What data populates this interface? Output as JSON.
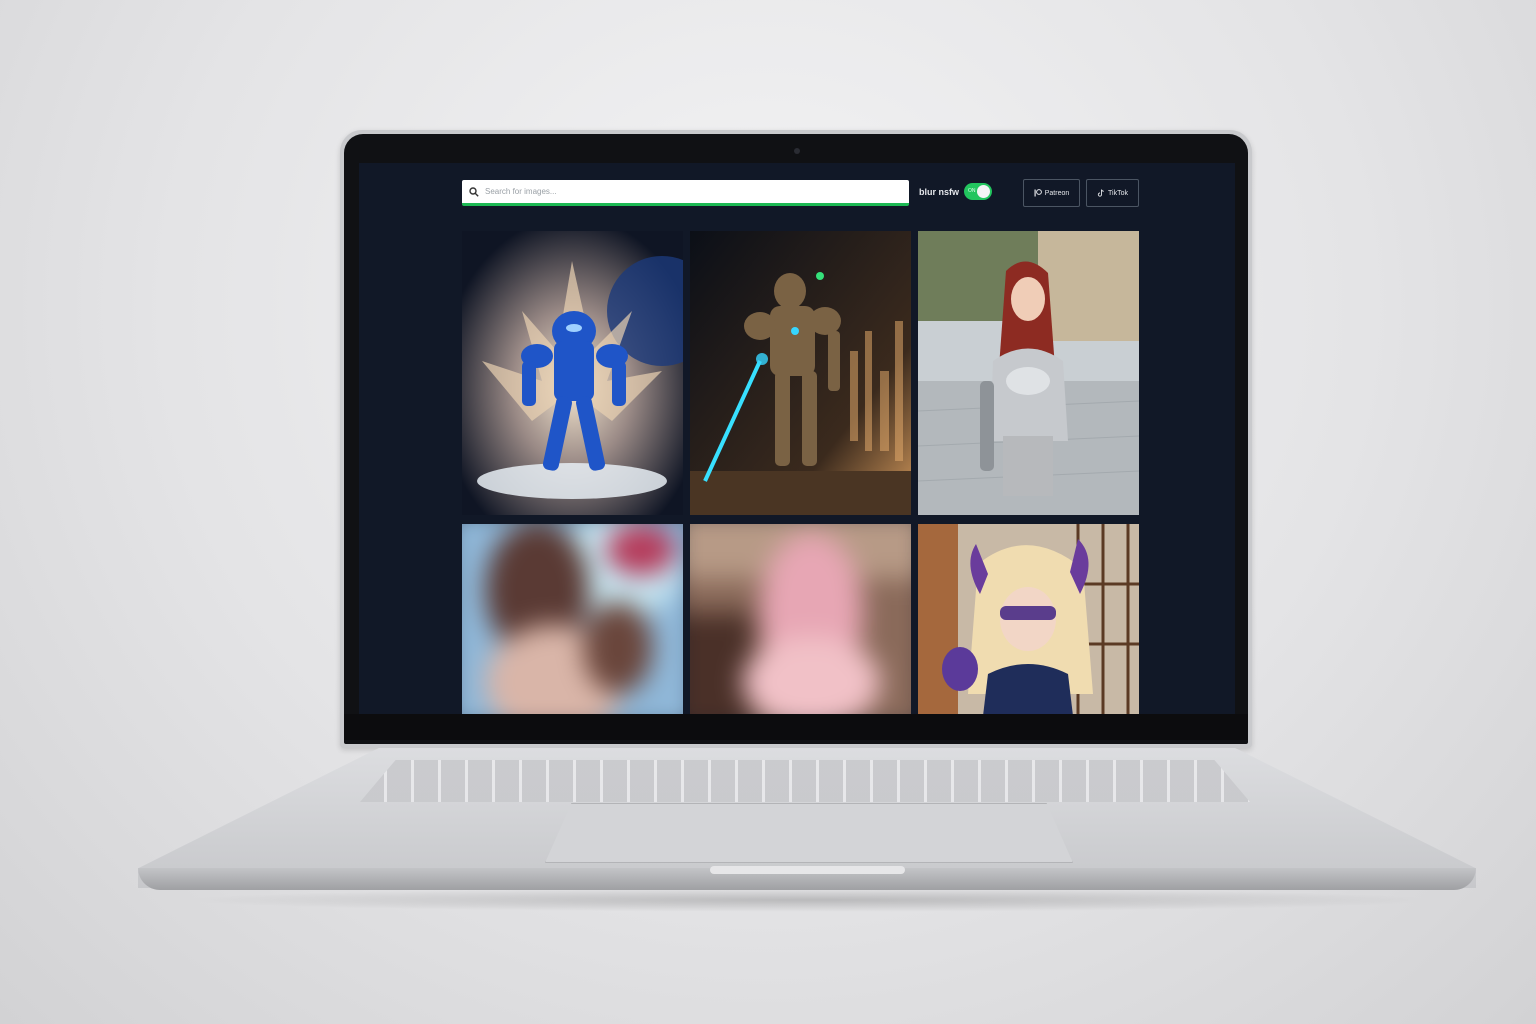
{
  "search": {
    "placeholder": "Search for images..."
  },
  "blur_nsfw": {
    "label": "blur nsfw",
    "state_text": "ON",
    "enabled": true
  },
  "links": {
    "patreon_label": "Patreon",
    "tiktok_label": "TikTok"
  },
  "gallery": {
    "images": [
      {
        "subject": "blue mecha robot",
        "blurred": false
      },
      {
        "subject": "armored warrior with glowing sword",
        "blurred": false
      },
      {
        "subject": "red-haired knight in silver armor",
        "blurred": false
      },
      {
        "subject": "character portrait",
        "blurred": true
      },
      {
        "subject": "pink-haired character",
        "blurred": true
      },
      {
        "subject": "blonde hero with purple horns and mask",
        "blurred": false
      }
    ]
  },
  "colors": {
    "page_background": "#111827",
    "accent": "#22c55e",
    "search_underline": "#1db954"
  }
}
